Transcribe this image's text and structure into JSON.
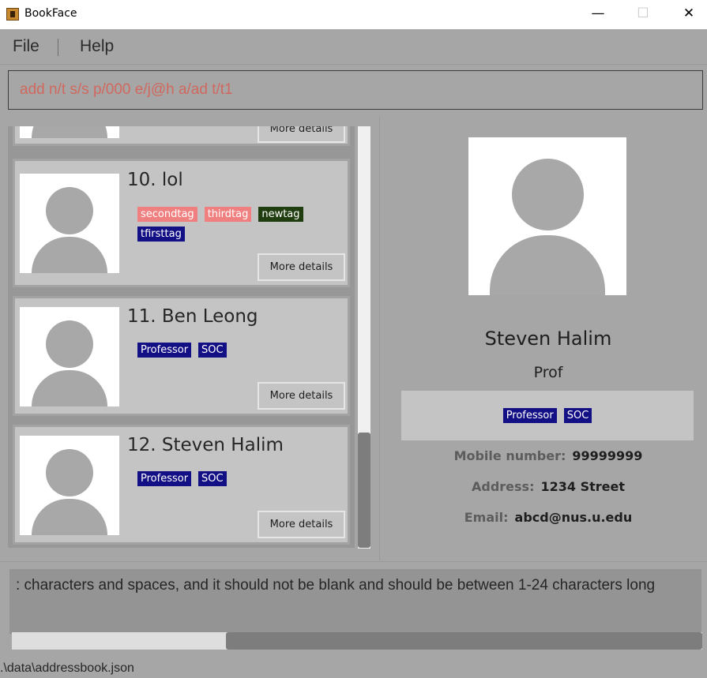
{
  "window": {
    "title": "BookFace",
    "minimize_glyph": "—",
    "maximize_glyph": "☐",
    "close_glyph": "✕"
  },
  "menu": {
    "file": "File",
    "help": "Help"
  },
  "command_box": {
    "value": "add n/t s/s p/000 e/j@h a/ad t/t1"
  },
  "person_list": {
    "partial_top_card": {
      "details_label": "More details"
    },
    "cards": [
      {
        "name": "10. lol",
        "tags": [
          {
            "label": "secondtag",
            "color": "#f08080"
          },
          {
            "label": "thirdtag",
            "color": "#f08080"
          },
          {
            "label": "newtag",
            "color": "#203d10"
          },
          {
            "label": "tfirsttag",
            "color": "#130f84"
          }
        ],
        "details_label": "More details"
      },
      {
        "name": "11. Ben Leong",
        "tags": [
          {
            "label": "Professor",
            "color": "#130f84"
          },
          {
            "label": "SOC",
            "color": "#130f84"
          }
        ],
        "details_label": "More details"
      },
      {
        "name": "12. Steven Halim",
        "tags": [
          {
            "label": "Professor",
            "color": "#130f84"
          },
          {
            "label": "SOC",
            "color": "#130f84"
          }
        ],
        "details_label": "More details"
      }
    ]
  },
  "person_detail": {
    "name": "Steven Halim",
    "role": "Prof",
    "tags": [
      {
        "label": "Professor",
        "color": "#130f84"
      },
      {
        "label": "SOC",
        "color": "#130f84"
      }
    ],
    "mobile_label": "Mobile number:",
    "mobile_value": "99999999",
    "address_label": "Address:",
    "address_value": "1234 Street",
    "email_label": "Email:",
    "email_value": "abcd@nus.u.edu"
  },
  "result_display": {
    "text": ": characters and spaces, and it should not be blank and should be between 1-24 characters long"
  },
  "status_bar": {
    "path": ".\\data\\addressbook.json"
  }
}
